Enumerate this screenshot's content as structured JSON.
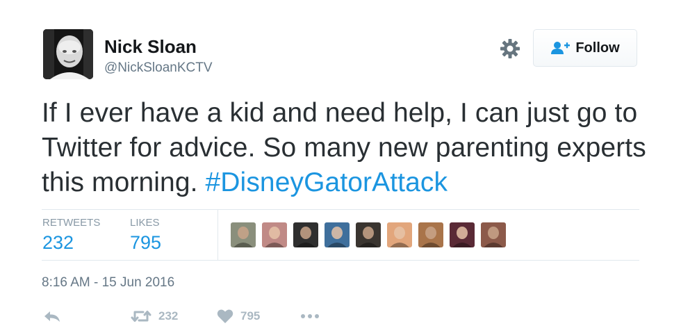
{
  "author": {
    "name": "Nick Sloan",
    "handle": "@NickSloanKCTV"
  },
  "header": {
    "gear_icon": "gear-icon",
    "follow_label": "Follow",
    "follow_icon": "add-user-icon"
  },
  "tweet": {
    "text": "If I ever have a kid and need help, I can just go to Twitter for advice. So many new parenting experts this morning. ",
    "hashtag": "#DisneyGatorAttack"
  },
  "stats": {
    "retweets_label": "RETWEETS",
    "retweets_value": "232",
    "likes_label": "LIKES",
    "likes_value": "795"
  },
  "likers": [
    {
      "color": "#8a8f7c"
    },
    {
      "color": "#c08a86"
    },
    {
      "color": "#2f2f2f"
    },
    {
      "color": "#3f6f9c"
    },
    {
      "color": "#3a3530"
    },
    {
      "color": "#e2a67c"
    },
    {
      "color": "#a9744a"
    },
    {
      "color": "#5a2a36"
    },
    {
      "color": "#8c5a4a"
    }
  ],
  "timestamp": "8:16 AM - 15 Jun 2016",
  "actions": {
    "reply_icon": "reply-icon",
    "retweet_icon": "retweet-icon",
    "retweet_count": "232",
    "like_icon": "heart-icon",
    "like_count": "795",
    "more_icon": "more-icon"
  },
  "colors": {
    "link": "#1b95e0",
    "muted": "#657786",
    "action_gray": "#aab8c2"
  }
}
